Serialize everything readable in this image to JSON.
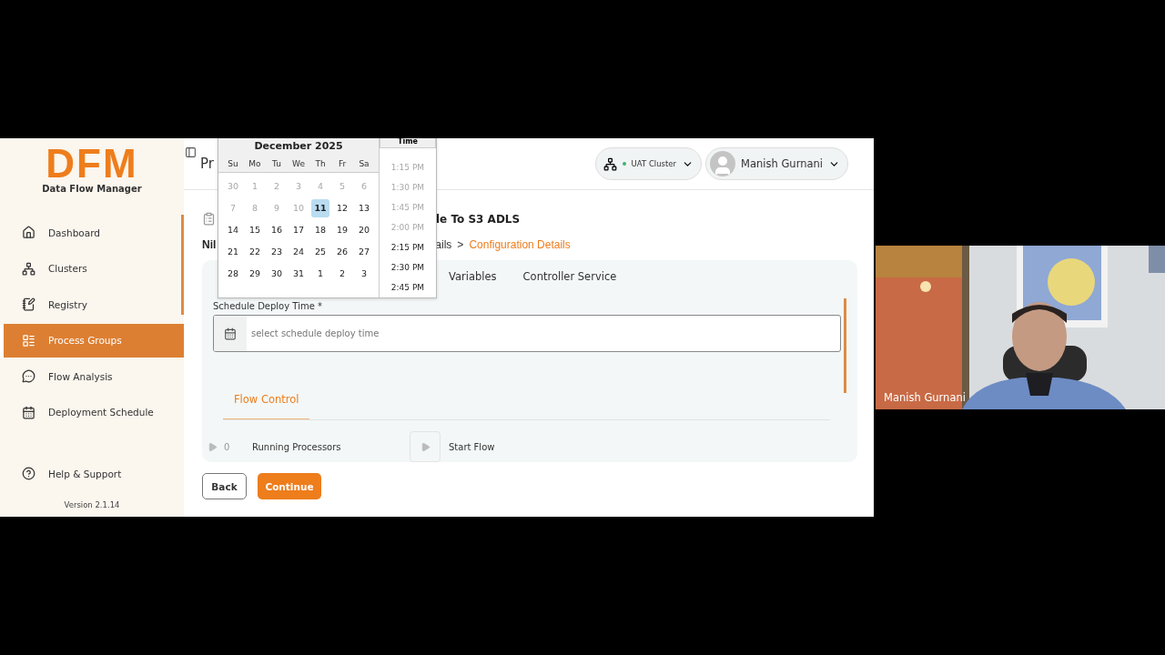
{
  "sidebar": {
    "logo": "DFM",
    "subtitle": "Data Flow Manager",
    "items": [
      {
        "label": "Dashboard",
        "selected": false
      },
      {
        "label": "Clusters",
        "selected": false
      },
      {
        "label": "Registry",
        "selected": false
      },
      {
        "label": "Process Groups",
        "selected": true
      },
      {
        "label": "Flow Analysis",
        "selected": false
      },
      {
        "label": "Deployment Schedule",
        "selected": false
      }
    ],
    "help": "Help & Support",
    "version": "Version 2.1.14"
  },
  "header": {
    "title_fragment": "Pr",
    "cluster": "UAT Cluster",
    "user": "Manish Gurnani"
  },
  "page": {
    "title_fragment": "le To S3 ADLS",
    "breadcrumb_left": "Nil",
    "breadcrumb_mid": "ails",
    "separator": ">",
    "breadcrumb_current": "Configuration Details"
  },
  "tabs": [
    {
      "label": "Variables",
      "selected": false
    },
    {
      "label": "Controller Service",
      "selected": false
    }
  ],
  "schedule": {
    "label": "Schedule Deploy Time *",
    "placeholder": "select schedule deploy time"
  },
  "flow_control": {
    "tab": "Flow Control",
    "count": "0",
    "running": "Running Processors",
    "start": "Start Flow"
  },
  "buttons": {
    "back": "Back",
    "continue": "Continue"
  },
  "datepicker": {
    "month": "December 2025",
    "time_header": "Time",
    "weekdays": [
      "Su",
      "Mo",
      "Tu",
      "We",
      "Th",
      "Fr",
      "Sa"
    ],
    "weeks": [
      [
        {
          "label": "30",
          "disabled": true,
          "selected": false
        },
        {
          "label": "1",
          "disabled": true,
          "selected": false
        },
        {
          "label": "2",
          "disabled": true,
          "selected": false
        },
        {
          "label": "3",
          "disabled": true,
          "selected": false
        },
        {
          "label": "4",
          "disabled": true,
          "selected": false
        },
        {
          "label": "5",
          "disabled": true,
          "selected": false
        },
        {
          "label": "6",
          "disabled": true,
          "selected": false
        }
      ],
      [
        {
          "label": "7",
          "disabled": true,
          "selected": false
        },
        {
          "label": "8",
          "disabled": true,
          "selected": false
        },
        {
          "label": "9",
          "disabled": true,
          "selected": false
        },
        {
          "label": "10",
          "disabled": true,
          "selected": false
        },
        {
          "label": "11",
          "disabled": false,
          "selected": true
        },
        {
          "label": "12",
          "disabled": false,
          "selected": false
        },
        {
          "label": "13",
          "disabled": false,
          "selected": false
        }
      ],
      [
        {
          "label": "14",
          "disabled": false,
          "selected": false
        },
        {
          "label": "15",
          "disabled": false,
          "selected": false
        },
        {
          "label": "16",
          "disabled": false,
          "selected": false
        },
        {
          "label": "17",
          "disabled": false,
          "selected": false
        },
        {
          "label": "18",
          "disabled": false,
          "selected": false
        },
        {
          "label": "19",
          "disabled": false,
          "selected": false
        },
        {
          "label": "20",
          "disabled": false,
          "selected": false
        }
      ],
      [
        {
          "label": "21",
          "disabled": false,
          "selected": false
        },
        {
          "label": "22",
          "disabled": false,
          "selected": false
        },
        {
          "label": "23",
          "disabled": false,
          "selected": false
        },
        {
          "label": "24",
          "disabled": false,
          "selected": false
        },
        {
          "label": "25",
          "disabled": false,
          "selected": false
        },
        {
          "label": "26",
          "disabled": false,
          "selected": false
        },
        {
          "label": "27",
          "disabled": false,
          "selected": false
        }
      ],
      [
        {
          "label": "28",
          "disabled": false,
          "selected": false
        },
        {
          "label": "29",
          "disabled": false,
          "selected": false
        },
        {
          "label": "30",
          "disabled": false,
          "selected": false
        },
        {
          "label": "31",
          "disabled": false,
          "selected": false
        },
        {
          "label": "1",
          "disabled": false,
          "selected": false
        },
        {
          "label": "2",
          "disabled": false,
          "selected": false
        },
        {
          "label": "3",
          "disabled": false,
          "selected": false
        }
      ]
    ],
    "times": [
      {
        "label": "1:15 PM",
        "disabled": true
      },
      {
        "label": "1:30 PM",
        "disabled": true
      },
      {
        "label": "1:45 PM",
        "disabled": true
      },
      {
        "label": "2:00 PM",
        "disabled": true
      },
      {
        "label": "2:15 PM",
        "disabled": false
      },
      {
        "label": "2:30 PM",
        "disabled": false
      },
      {
        "label": "2:45 PM",
        "disabled": false
      }
    ]
  },
  "video": {
    "kind": "picture",
    "name": "Manish Gurnani"
  }
}
